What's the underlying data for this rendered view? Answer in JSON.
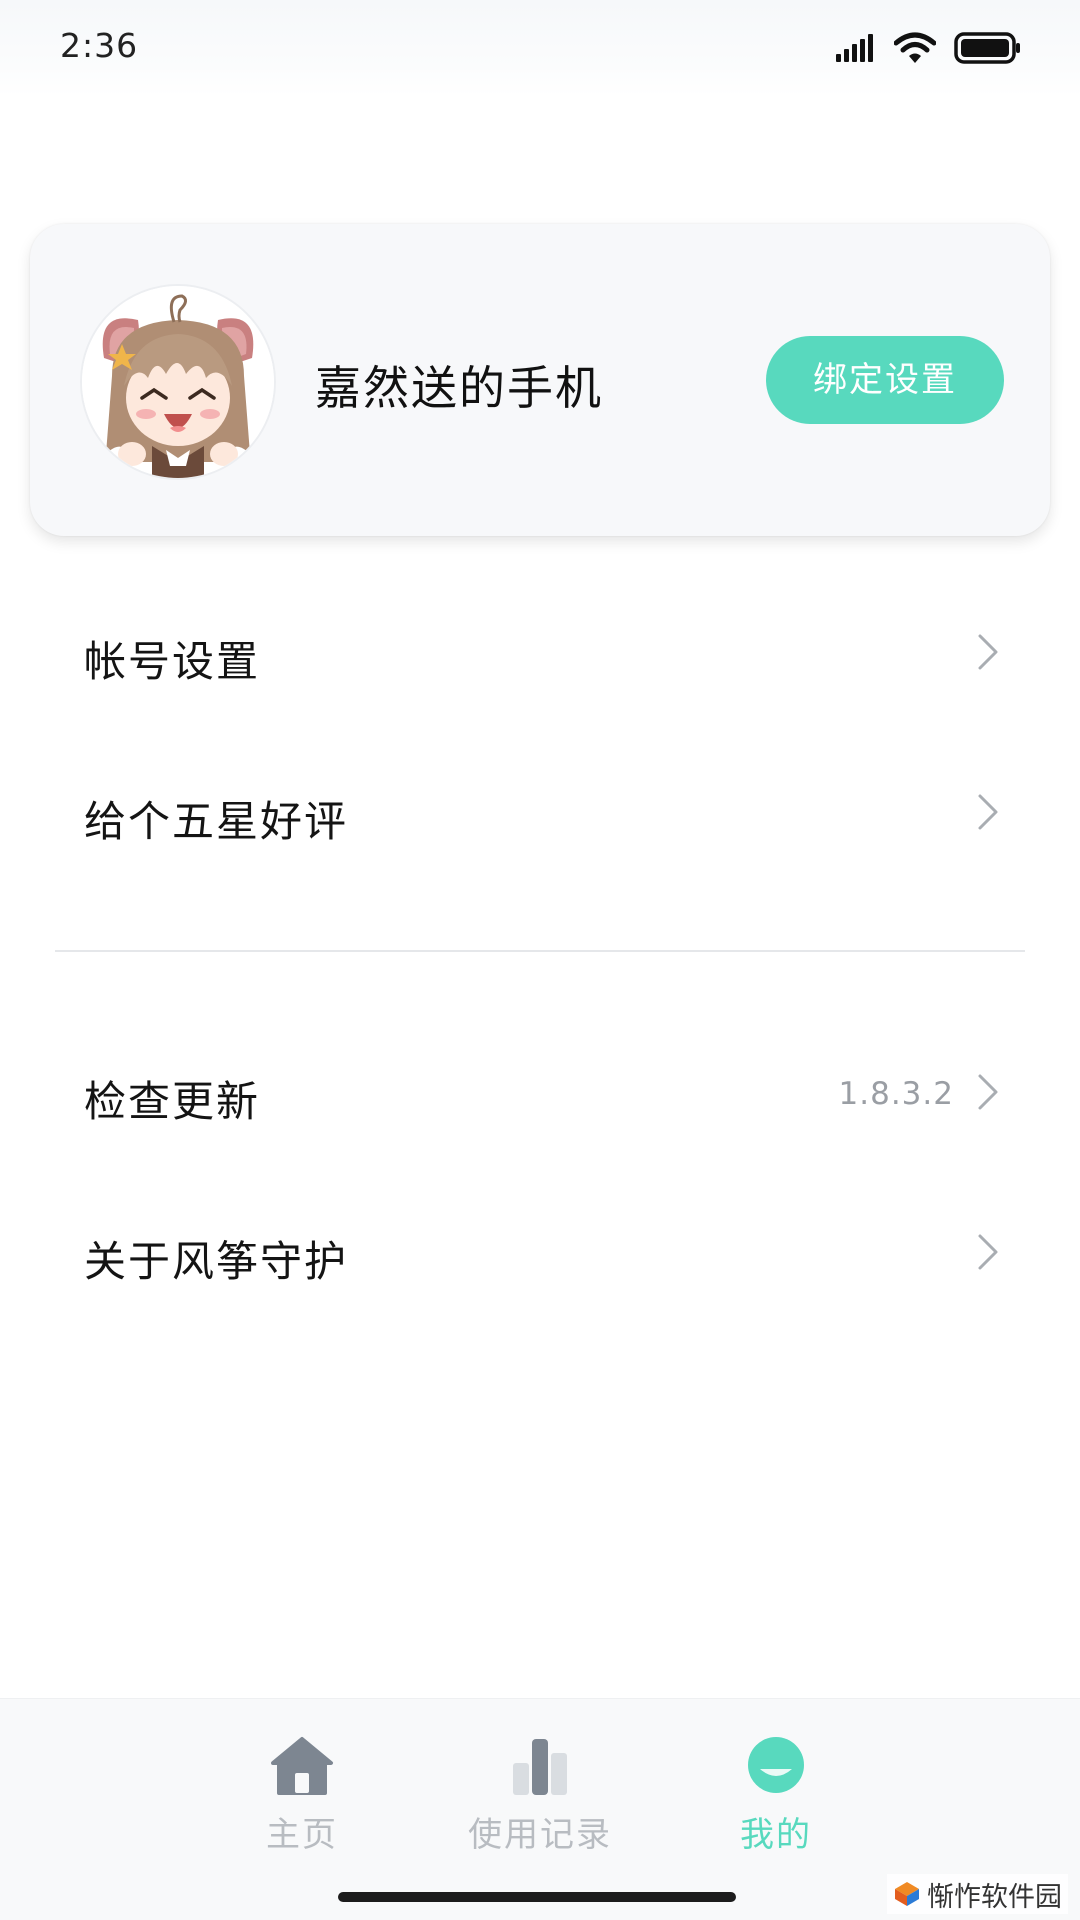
{
  "status_bar": {
    "time": "2:36",
    "icons": [
      "signal-icon",
      "wifi-icon",
      "battery-icon"
    ]
  },
  "profile": {
    "device_name": "嘉然送的手机",
    "bind_button_label": "绑定设置",
    "avatar_icon": "anime-girl-avatar"
  },
  "menu": {
    "group1": [
      {
        "label": "帐号设置"
      },
      {
        "label": "给个五星好评"
      }
    ],
    "group2": [
      {
        "label": "检查更新",
        "value": "1.8.3.2"
      },
      {
        "label": "关于风筝守护"
      }
    ]
  },
  "nav": {
    "tabs": [
      {
        "label": "主页",
        "icon": "home-icon",
        "active": false
      },
      {
        "label": "使用记录",
        "icon": "bar-chart-icon",
        "active": false
      },
      {
        "label": "我的",
        "icon": "profile-icon",
        "active": true
      }
    ]
  },
  "watermark": {
    "text": "惭怍软件园"
  },
  "colors": {
    "accent": "#58d9be",
    "card_bg": "#f7f8fa",
    "nav_inactive": "#b8bcc1",
    "nav_icon_gray": "#7d8691"
  }
}
